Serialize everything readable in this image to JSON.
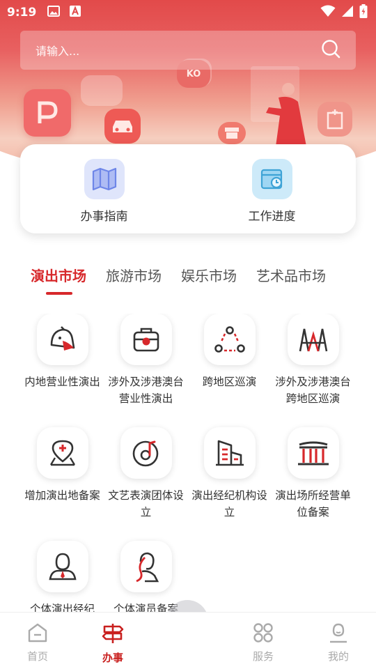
{
  "status_bar": {
    "time": "9:19"
  },
  "search": {
    "placeholder": "请输入..."
  },
  "quick_actions": [
    {
      "label": "办事指南",
      "icon": "map-icon"
    },
    {
      "label": "工作进度",
      "icon": "progress-calendar-icon"
    }
  ],
  "tabs": [
    {
      "label": "演出市场",
      "active": true
    },
    {
      "label": "旅游市场",
      "active": false
    },
    {
      "label": "娱乐市场",
      "active": false
    },
    {
      "label": "艺术品市场",
      "active": false
    }
  ],
  "services": [
    {
      "label": "内地营业性演出",
      "icon": "performer-icon"
    },
    {
      "label": "涉外及涉港澳台营业性演出",
      "icon": "camera-bag-icon"
    },
    {
      "label": "跨地区巡演",
      "icon": "tour-cycle-icon"
    },
    {
      "label": "涉外及涉港澳台跨地区巡演",
      "icon": "stage-icon"
    },
    {
      "label": "增加演出地备案",
      "icon": "location-add-icon"
    },
    {
      "label": "文艺表演团体设立",
      "icon": "music-disc-icon"
    },
    {
      "label": "演出经纪机构设立",
      "icon": "building-icon"
    },
    {
      "label": "演出场所经营单位备案",
      "icon": "venue-icon"
    },
    {
      "label": "个体演出经纪",
      "icon": "agent-person-icon"
    },
    {
      "label": "个体演员备案",
      "icon": "performer-woman-icon"
    }
  ],
  "bottom_nav": [
    {
      "label": "首页",
      "icon": "home-icon",
      "active": false
    },
    {
      "label": "办事",
      "icon": "signpost-icon",
      "active": true
    },
    {
      "label": "",
      "icon": "",
      "active": false
    },
    {
      "label": "服务",
      "icon": "grid-icon",
      "active": false
    },
    {
      "label": "我的",
      "icon": "user-icon",
      "active": false
    }
  ],
  "colors": {
    "primary": "#d7282b",
    "hero_top": "#e24a4a",
    "text": "#333333",
    "muted": "#aaaaaa"
  }
}
